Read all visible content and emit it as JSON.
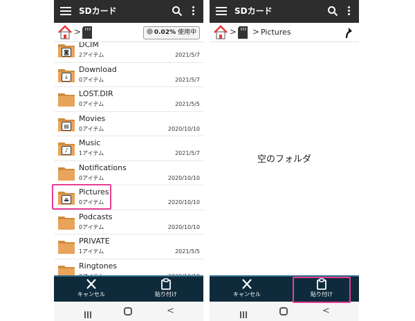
{
  "app": {
    "title": "SDカード"
  },
  "usage": {
    "percent": "0.02%",
    "label": "使用中"
  },
  "path": {
    "current": "Pictures"
  },
  "files": [
    {
      "name": "DCIM",
      "count": "2アイテム",
      "date": "2021/5/7",
      "badge": "camera"
    },
    {
      "name": "Download",
      "count": "0アイテム",
      "date": "2021/5/7",
      "badge": "download"
    },
    {
      "name": "LOST.DIR",
      "count": "0アイテム",
      "date": "2021/5/5",
      "badge": ""
    },
    {
      "name": "Movies",
      "count": "0アイテム",
      "date": "2020/10/10",
      "badge": "film"
    },
    {
      "name": "Music",
      "count": "1アイテム",
      "date": "2021/5/7",
      "badge": "music"
    },
    {
      "name": "Notifications",
      "count": "0アイテム",
      "date": "2020/10/10",
      "badge": ""
    },
    {
      "name": "Pictures",
      "count": "0アイテム",
      "date": "2020/10/10",
      "badge": "picture"
    },
    {
      "name": "Podcasts",
      "count": "0アイテム",
      "date": "2020/10/10",
      "badge": ""
    },
    {
      "name": "PRIVATE",
      "count": "1アイテム",
      "date": "2021/5/5",
      "badge": ""
    },
    {
      "name": "Ringtones",
      "count": "0アイテム",
      "date": "2020/10/10",
      "badge": ""
    }
  ],
  "empty_message": "空のフォルダ",
  "actions": {
    "cancel": "キャンセル",
    "paste": "貼り付け"
  },
  "colors": {
    "appbar": "#2d2d2d",
    "bottombar": "#0f2b3b",
    "folder": "#e8a45a",
    "highlight": "#e83d95",
    "home_roof": "#e53935"
  }
}
